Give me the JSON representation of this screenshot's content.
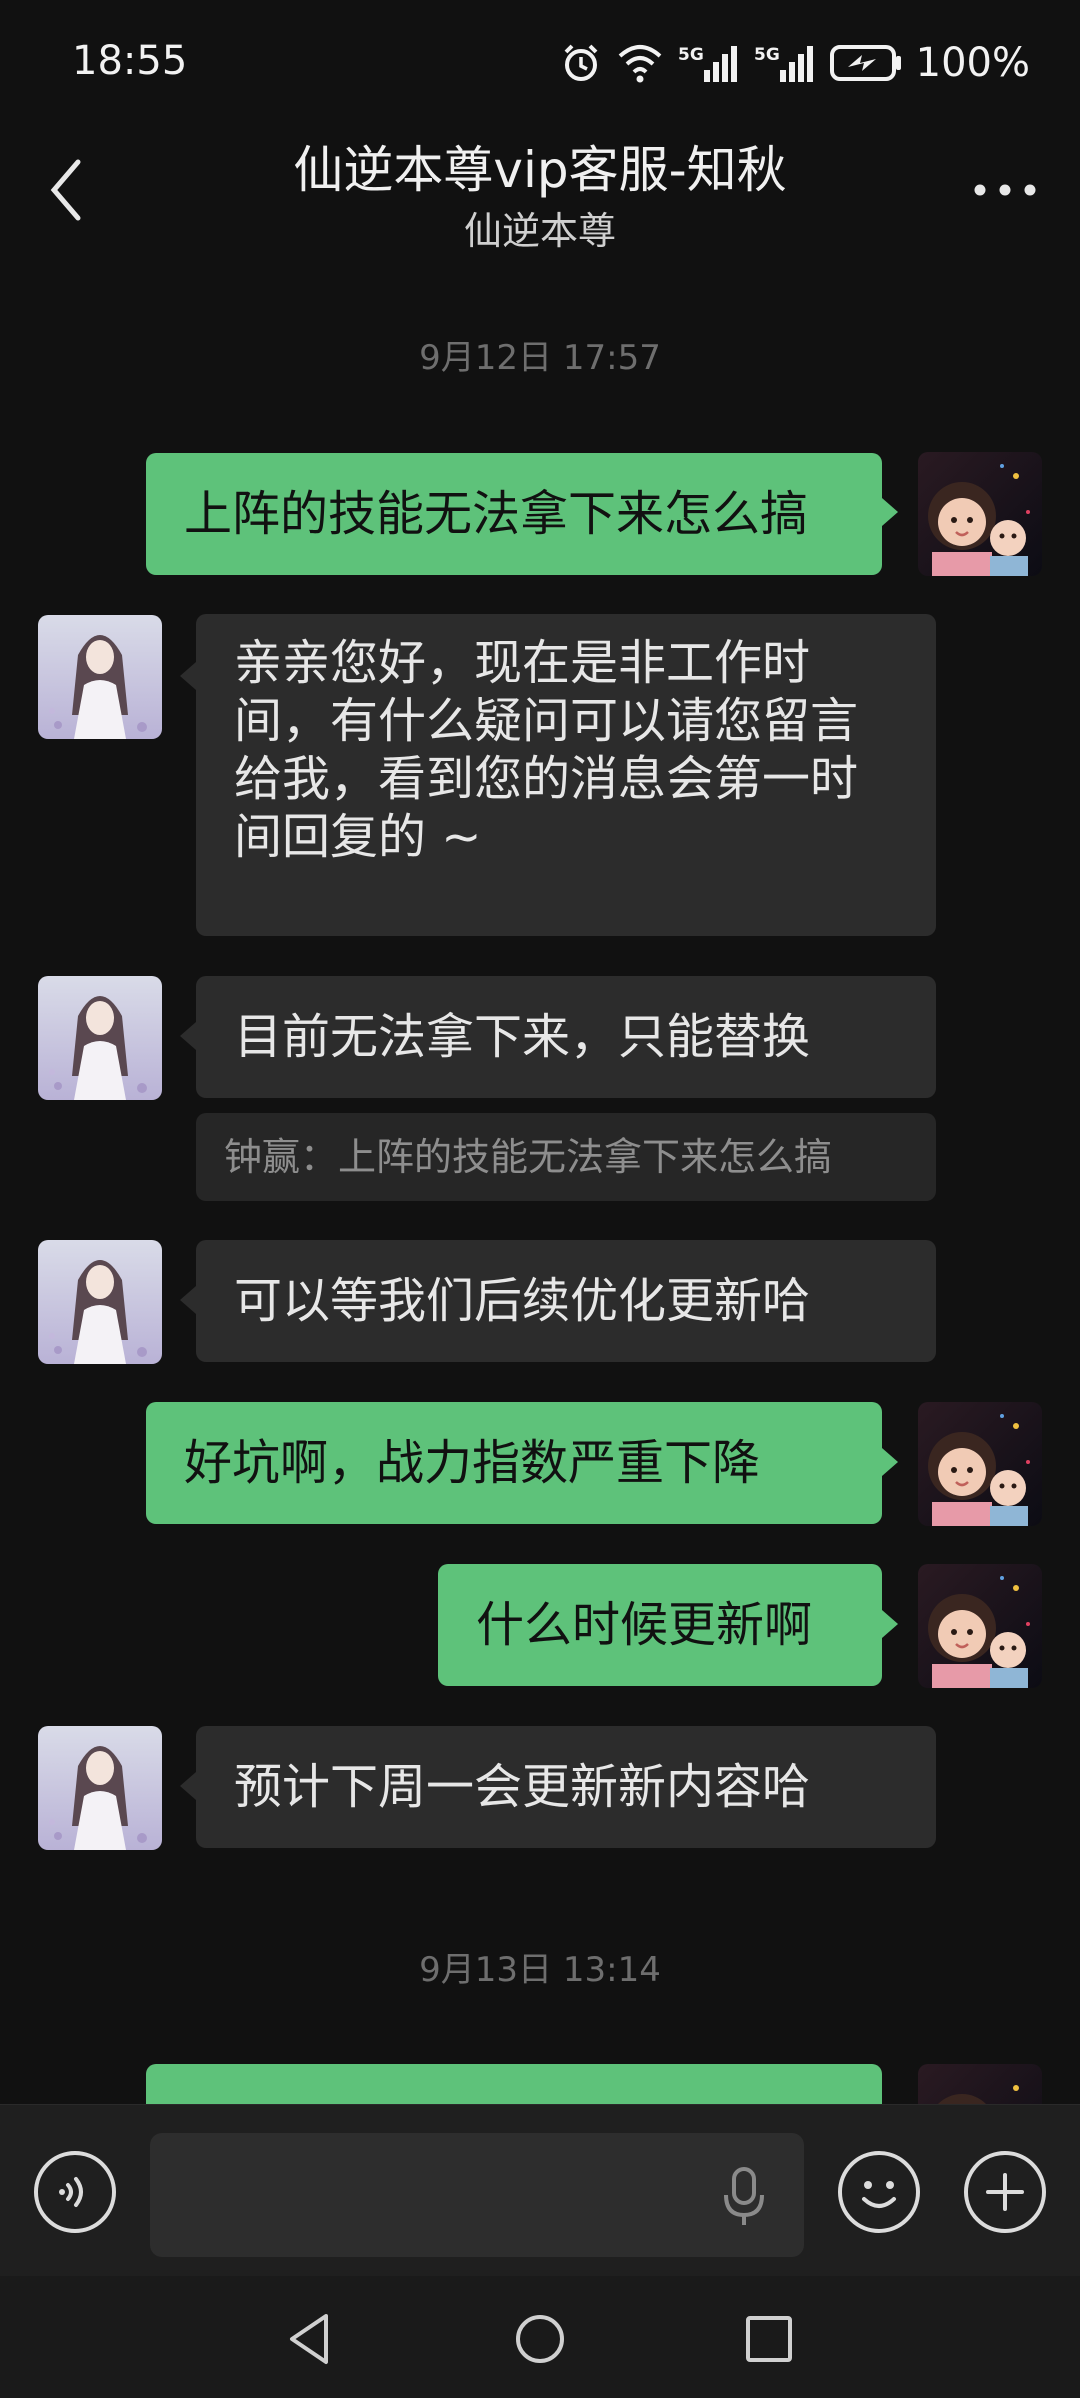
{
  "status_bar": {
    "time": "18:55",
    "battery": "100%",
    "icons": [
      "alarm-icon",
      "wifi-icon",
      "signal-5g-icon",
      "signal-5g-icon",
      "battery-charging-icon"
    ]
  },
  "chat_header": {
    "title": "仙逆本尊vip客服-知秋",
    "subtitle": "仙逆本尊"
  },
  "messages": {
    "timestamp_1": "9月12日 17:57",
    "m1": "上阵的技能无法拿下来怎么搞",
    "m2_line1": "亲亲您好，现在是非工作时",
    "m2_line2": "间，有什么疑问可以请您留言",
    "m2_line3": "给我，看到您的消息会第一时",
    "m2_line4": "间回复的 ~",
    "m3": "目前无法拿下来，只能替换",
    "m3_quote": "钟赢：上阵的技能无法拿下来怎么搞",
    "m4": "可以等我们后续优化更新哈",
    "m5": "好坑啊，战力指数严重下降",
    "m6": "什么时候更新啊",
    "m7": "预计下周一会更新新内容哈",
    "timestamp_2": "9月13日 13:14"
  },
  "colors": {
    "background": "#111111",
    "my_bubble": "#5ec27a",
    "other_bubble": "#2c2c2c",
    "timestamp": "#6e6e6e"
  }
}
